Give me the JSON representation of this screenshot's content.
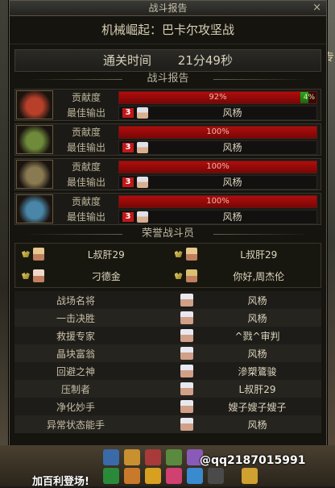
{
  "window": {
    "title": "战斗报告",
    "close_glyph": "×"
  },
  "stage_title": "机械崛起：巴卡尔攻坚战",
  "clear_time": {
    "label": "通关时间",
    "value": "21分49秒"
  },
  "sections": {
    "report": "战斗报告",
    "honor": "荣誉战斗员"
  },
  "side_text": "药专",
  "players": [
    {
      "label_contrib": "贡献度",
      "label_best": "最佳输出",
      "contrib_pct": 92,
      "contrib_text": "92%",
      "secondary_pct": 4,
      "secondary_text": "4%",
      "level_badge": "3",
      "best_name": "风杨",
      "portrait_color": "#b8402a"
    },
    {
      "label_contrib": "贡献度",
      "label_best": "最佳输出",
      "contrib_pct": 100,
      "contrib_text": "100%",
      "level_badge": "3",
      "best_name": "风杨",
      "portrait_color": "#6e8a3a"
    },
    {
      "label_contrib": "贡献度",
      "label_best": "最佳输出",
      "contrib_pct": 100,
      "contrib_text": "100%",
      "level_badge": "3",
      "best_name": "风杨",
      "portrait_color": "#8a7a52"
    },
    {
      "label_contrib": "贡献度",
      "label_best": "最佳输出",
      "contrib_pct": 100,
      "contrib_text": "100%",
      "level_badge": "3",
      "best_name": "风杨",
      "portrait_color": "#4a86a8"
    }
  ],
  "honor_members": [
    "L叔肝29",
    "L叔肝29",
    "刁德金",
    "你好,周杰伦"
  ],
  "awards": [
    {
      "title": "战场名将",
      "name": "风杨"
    },
    {
      "title": "一击决胜",
      "name": "风杨"
    },
    {
      "title": "救援专家",
      "name": "^戮^审判"
    },
    {
      "title": "晶块富翁",
      "name": "风杨"
    },
    {
      "title": "回避之神",
      "name": "滲槊鷟骏"
    },
    {
      "title": "压制者",
      "name": "L叔肝29"
    },
    {
      "title": "净化妙手",
      "name": "嫂子嫂子嫂子"
    },
    {
      "title": "异常状态能手",
      "name": "风杨"
    }
  ],
  "bottom": {
    "watermark": "@qq2187015991",
    "join_text": "加百利登场!"
  },
  "colors": {
    "bar_red": "#b00d0d",
    "bar_green": "#2da51c",
    "accent": "#c01818"
  }
}
